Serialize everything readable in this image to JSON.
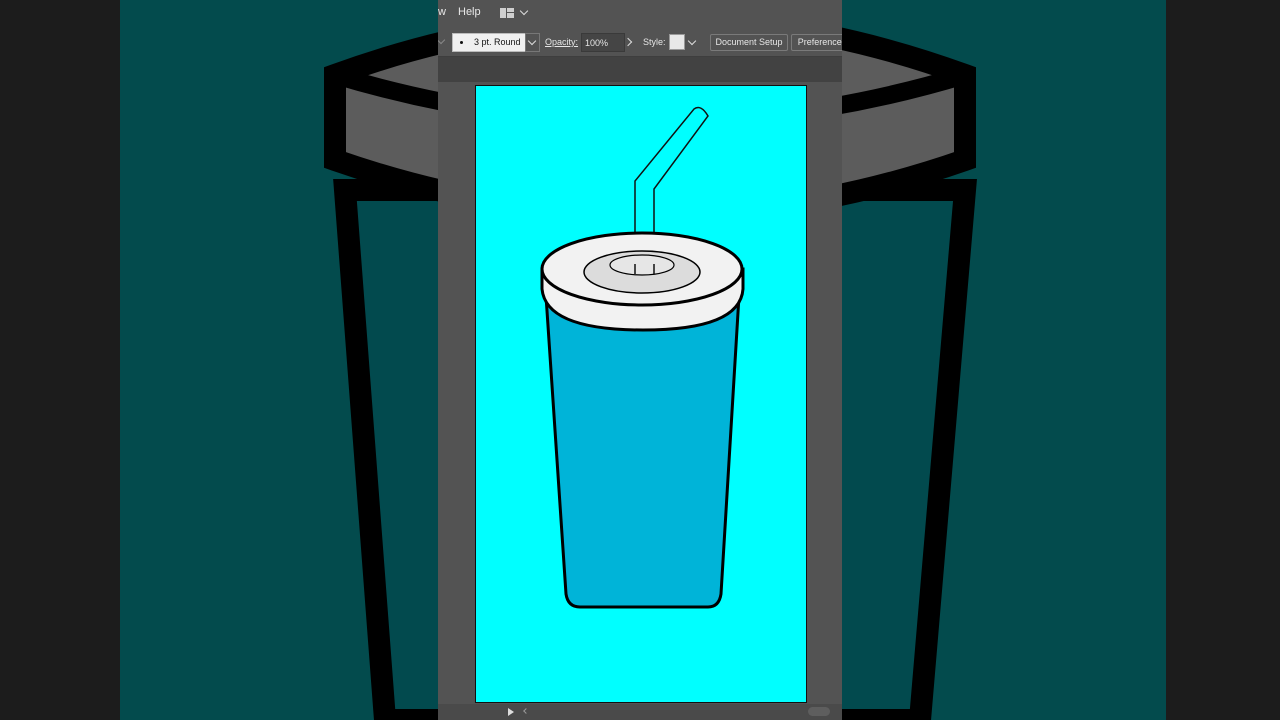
{
  "menu": {
    "partial_item": "w",
    "help": "Help"
  },
  "control_bar": {
    "stroke_profile": "3 pt. Round",
    "opacity_label": "Opacity:",
    "opacity_value": "100%",
    "style_label": "Style:",
    "document_setup": "Document Setup",
    "preferences": "Preferences"
  },
  "colors": {
    "artboard": "#00ffff",
    "cup_body": "#00b4d8",
    "lid": "#f2f2f2",
    "lid_inner": "#dcdcdc",
    "background_blur": "#034b4d",
    "app_chrome": "#535353"
  },
  "icons": [
    "workspace-switcher-icon",
    "chevron-down-icon",
    "chevron-right-icon",
    "play-icon",
    "scroll-left-icon"
  ]
}
